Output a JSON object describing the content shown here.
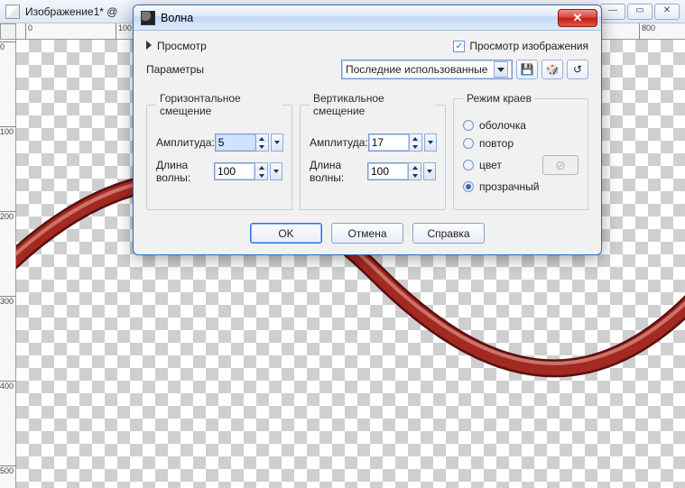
{
  "editor": {
    "title": "Изображение1* @",
    "ruler_h": [
      "0",
      "100",
      "800"
    ],
    "ruler_v": [
      "0",
      "100",
      "200",
      "300",
      "400",
      "500"
    ]
  },
  "dialog": {
    "title": "Волна",
    "preview_toggle": "Просмотр",
    "preview_image": "Просмотр изображения",
    "params_label": "Параметры",
    "preset": "Последние использованные",
    "group_h": {
      "legend": "Горизонтальное смещение",
      "amplitude_label": "Амплитуда:",
      "amplitude": "5",
      "wavelength_label": "Длина волны:",
      "wavelength": "100"
    },
    "group_v": {
      "legend": "Вертикальное смещение",
      "amplitude_label": "Амплитуда:",
      "amplitude": "17",
      "wavelength_label": "Длина волны:",
      "wavelength": "100"
    },
    "edges": {
      "legend": "Режим краев",
      "options": {
        "wrap": "оболочка",
        "repeat": "повтор",
        "color": "цвет",
        "transparent": "прозрачный"
      },
      "selected": "transparent"
    },
    "buttons": {
      "ok": "OK",
      "cancel": "Отмена",
      "help": "Справка"
    }
  }
}
